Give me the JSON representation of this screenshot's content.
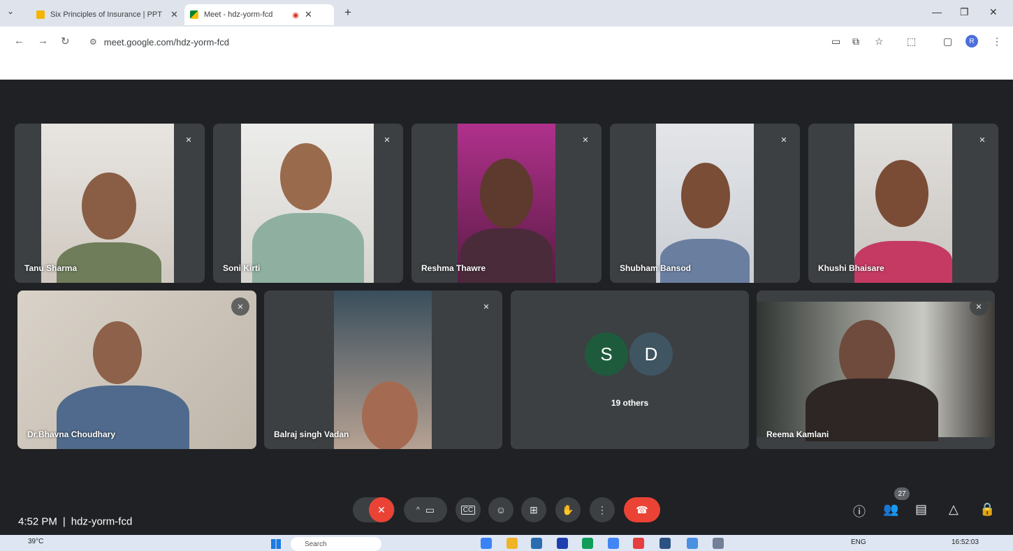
{
  "browser": {
    "tabs": [
      {
        "title": "Six Principles of Insurance | PPT",
        "active": false
      },
      {
        "title": "Meet - hdz-yorm-fcd",
        "active": true
      }
    ],
    "url": "meet.google.com/hdz-yorm-fcd",
    "profile_initial": "R"
  },
  "meet": {
    "time": "4:52 PM",
    "separator": "|",
    "code": "hdz-yorm-fcd",
    "participant_count": "27",
    "tiles_row1": [
      {
        "name": "Tanu Sharma",
        "muted": true
      },
      {
        "name": "Soni Kirti",
        "muted": true
      },
      {
        "name": "Reshma Thawre",
        "muted": true
      },
      {
        "name": "Shubham Bansod",
        "muted": true
      },
      {
        "name": "Khushi Bhaisare",
        "muted": true
      }
    ],
    "tiles_row2": [
      {
        "name": "Dr.Bhavna Choudhary",
        "muted": true
      },
      {
        "name": "Balraj singh Vadan",
        "muted": true
      },
      {
        "name": "Reema Kamlani",
        "muted": true
      }
    ],
    "others": {
      "avatars": [
        "S",
        "D"
      ],
      "avatar_colors": [
        "#1e5b3c",
        "#3f5562"
      ],
      "label": "19 others"
    }
  },
  "taskbar": {
    "weather": "39°C",
    "search_placeholder": "Search",
    "language": "ENG",
    "clock": "16:52:03"
  },
  "colors": {
    "stage_bg": "#202124",
    "tile_bg": "#3c4043",
    "end_call_red": "#ea4335"
  }
}
